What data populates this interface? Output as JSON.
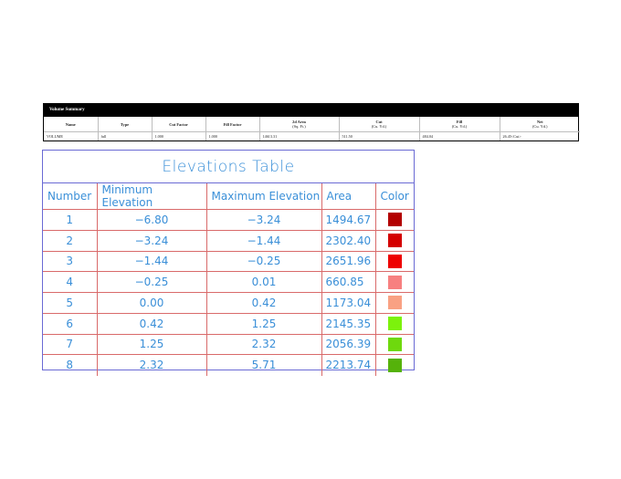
{
  "volume_summary": {
    "title": "Volume Summary",
    "columns": [
      {
        "label": "Name",
        "sub": ""
      },
      {
        "label": "Type",
        "sub": ""
      },
      {
        "label": "Cut Factor",
        "sub": ""
      },
      {
        "label": "Fill Factor",
        "sub": ""
      },
      {
        "label": "2d Area",
        "sub": "(Sq. Ft.)"
      },
      {
        "label": "Cut",
        "sub": "(Cu. Yd.)"
      },
      {
        "label": "Fill",
        "sub": "(Cu. Yd.)"
      },
      {
        "label": "Net",
        "sub": "(Cu. Yd.)"
      }
    ],
    "row": [
      "VOLUME",
      "full",
      "1.000",
      "1.000",
      "14613.31",
      "511.50",
      "484.04",
      "26.45<Cut>"
    ]
  },
  "elevations": {
    "title": "Elevations Table",
    "headers": [
      "Number",
      "Minimum Elevation",
      "Maximum Elevation",
      "Area",
      "Color"
    ],
    "rows": [
      {
        "number": "1",
        "min": "−6.80",
        "max": "−3.24",
        "area": "1494.67",
        "color": "#b30000"
      },
      {
        "number": "2",
        "min": "−3.24",
        "max": "−1.44",
        "area": "2302.40",
        "color": "#d40000"
      },
      {
        "number": "3",
        "min": "−1.44",
        "max": "−0.25",
        "area": "2651.96",
        "color": "#ee0000"
      },
      {
        "number": "4",
        "min": "−0.25",
        "max": "0.01",
        "area": "660.85",
        "color": "#f78080"
      },
      {
        "number": "5",
        "min": "0.00",
        "max": "0.42",
        "area": "1173.04",
        "color": "#f9a183"
      },
      {
        "number": "6",
        "min": "0.42",
        "max": "1.25",
        "area": "2145.35",
        "color": "#7cf20c"
      },
      {
        "number": "7",
        "min": "1.25",
        "max": "2.32",
        "area": "2056.39",
        "color": "#6ed90d"
      },
      {
        "number": "8",
        "min": "2.32",
        "max": "5.71",
        "area": "2213.74",
        "color": "#55b20a"
      }
    ]
  }
}
